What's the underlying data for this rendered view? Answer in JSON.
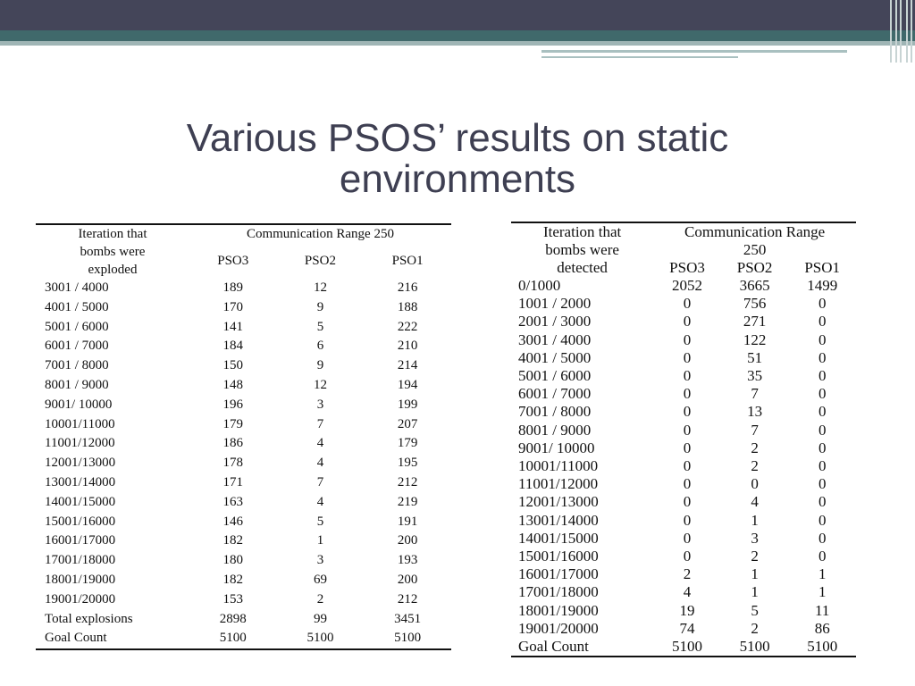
{
  "slide": {
    "title_line1": "Various PSOS’ results on static",
    "title_line2": "environments",
    "theme_colors": {
      "header_dark": "#444559",
      "header_teal": "#40696b",
      "title_text": "#3e3f52"
    }
  },
  "table_left": {
    "header_iteration": [
      "Iteration that",
      "bombs were",
      "exploded"
    ],
    "header_group": "Communication Range 250",
    "columns": [
      "PSO3",
      "PSO2",
      "PSO1"
    ],
    "rows": [
      [
        "3001 / 4000",
        "189",
        "12",
        "216"
      ],
      [
        "4001 / 5000",
        "170",
        "9",
        "188"
      ],
      [
        "5001 / 6000",
        "141",
        "5",
        "222"
      ],
      [
        "6001 / 7000",
        "184",
        "6",
        "210"
      ],
      [
        "7001 / 8000",
        "150",
        "9",
        "214"
      ],
      [
        "8001 / 9000",
        "148",
        "12",
        "194"
      ],
      [
        "9001/ 10000",
        "196",
        "3",
        "199"
      ],
      [
        "10001/11000",
        "179",
        "7",
        "207"
      ],
      [
        "11001/12000",
        "186",
        "4",
        "179"
      ],
      [
        "12001/13000",
        "178",
        "4",
        "195"
      ],
      [
        "13001/14000",
        "171",
        "7",
        "212"
      ],
      [
        "14001/15000",
        "163",
        "4",
        "219"
      ],
      [
        "15001/16000",
        "146",
        "5",
        "191"
      ],
      [
        "16001/17000",
        "182",
        "1",
        "200"
      ],
      [
        "17001/18000",
        "180",
        "3",
        "193"
      ],
      [
        "18001/19000",
        "182",
        "69",
        "200"
      ],
      [
        "19001/20000",
        "153",
        "2",
        "212"
      ],
      [
        "Total explosions",
        "2898",
        "99",
        "3451"
      ],
      [
        "Goal Count",
        "5100",
        "5100",
        "5100"
      ]
    ]
  },
  "table_right": {
    "header_iteration": [
      "Iteration that",
      "bombs were",
      "detected"
    ],
    "header_group": [
      "Communication Range",
      "250"
    ],
    "columns": [
      "PSO3",
      "PSO2",
      "PSO1"
    ],
    "rows": [
      [
        "0/1000",
        "2052",
        "3665",
        "1499"
      ],
      [
        "1001 / 2000",
        "0",
        "756",
        "0"
      ],
      [
        "2001 / 3000",
        "0",
        "271",
        "0"
      ],
      [
        "3001 / 4000",
        "0",
        "122",
        "0"
      ],
      [
        "4001 / 5000",
        "0",
        "51",
        "0"
      ],
      [
        "5001 / 6000",
        "0",
        "35",
        "0"
      ],
      [
        "6001 / 7000",
        "0",
        "7",
        "0"
      ],
      [
        "7001 / 8000",
        "0",
        "13",
        "0"
      ],
      [
        "8001 / 9000",
        "0",
        "7",
        "0"
      ],
      [
        "9001/ 10000",
        "0",
        "2",
        "0"
      ],
      [
        "10001/11000",
        "0",
        "2",
        "0"
      ],
      [
        "11001/12000",
        "0",
        "0",
        "0"
      ],
      [
        "12001/13000",
        "0",
        "4",
        "0"
      ],
      [
        "13001/14000",
        "0",
        "1",
        "0"
      ],
      [
        "14001/15000",
        "0",
        "3",
        "0"
      ],
      [
        "15001/16000",
        "0",
        "2",
        "0"
      ],
      [
        "16001/17000",
        "2",
        "1",
        "1"
      ],
      [
        "17001/18000",
        "4",
        "1",
        "1"
      ],
      [
        "18001/19000",
        "19",
        "5",
        "11"
      ],
      [
        "19001/20000",
        "74",
        "2",
        "86"
      ],
      [
        "Goal Count",
        "5100",
        "5100",
        "5100"
      ]
    ]
  }
}
